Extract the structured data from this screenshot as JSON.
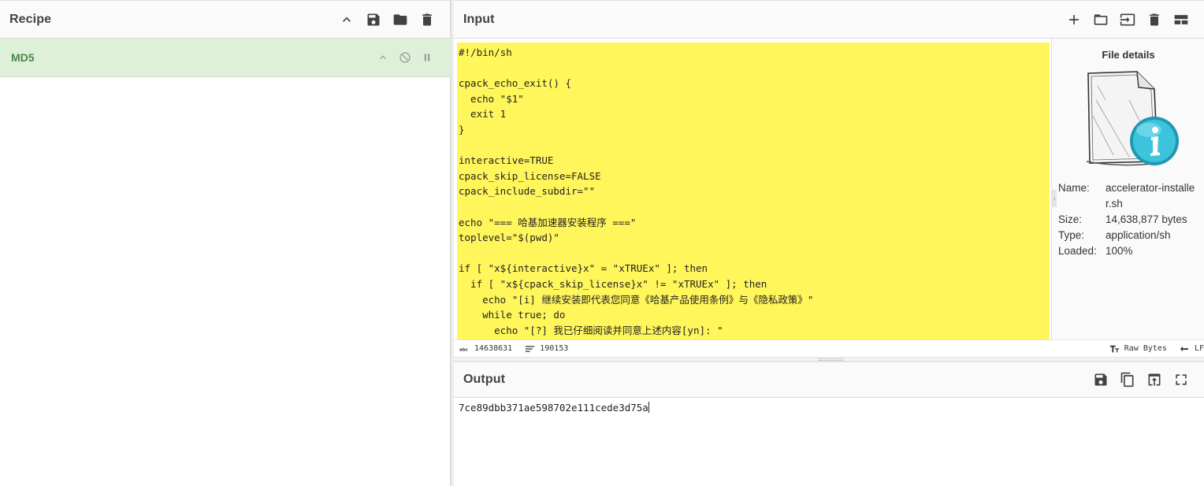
{
  "recipe": {
    "title": "Recipe",
    "icons": [
      "chevron-up-icon",
      "save-icon",
      "folder-icon",
      "trash-icon"
    ],
    "operations": [
      {
        "name": "MD5",
        "icons": [
          "chevron-up-icon",
          "disable-icon",
          "pause-icon"
        ]
      }
    ]
  },
  "input": {
    "title": "Input",
    "icons": [
      "plus-icon",
      "folder-icon",
      "import-icon",
      "trash-icon",
      "layout-icon"
    ],
    "text": "#!/bin/sh\n\ncpack_echo_exit() {\n  echo \"$1\"\n  exit 1\n}\n\ninteractive=TRUE\ncpack_skip_license=FALSE\ncpack_include_subdir=\"\"\n\necho \"=== 哈基加速器安装程序 ===\"\ntoplevel=\"$(pwd)\"\n\nif [ \"x${interactive}x\" = \"xTRUEx\" ]; then\n  if [ \"x${cpack_skip_license}x\" != \"xTRUEx\" ]; then\n    echo \"[i] 继续安装即代表您同意《哈基产品使用条例》与《隐私政策》\"\n    while true; do\n      echo \"[?] 我已仔细阅读并同意上述内容[yn]: \"\n      read line leftover",
    "highlight_color": "#fff65b",
    "status": {
      "length": "14638631",
      "lines": "190153",
      "encoding": "Raw Bytes",
      "eol": "LF"
    }
  },
  "file_details": {
    "title": "File details",
    "fields": [
      {
        "key": "Name:",
        "value": "accelerator-installer.sh"
      },
      {
        "key": "Size:",
        "value": "14,638,877 bytes"
      },
      {
        "key": "Type:",
        "value": "application/sh"
      },
      {
        "key": "Loaded:",
        "value": "100%"
      }
    ]
  },
  "output": {
    "title": "Output",
    "icons": [
      "save-icon",
      "copy-icon",
      "replace-input-icon",
      "maximise-icon"
    ],
    "text": "7ce89dbb371ae598702e111cede3d75a"
  },
  "colors": {
    "accent_green": "#468847",
    "operation_bg": "#dff0d8",
    "highlight": "#fff65b"
  }
}
